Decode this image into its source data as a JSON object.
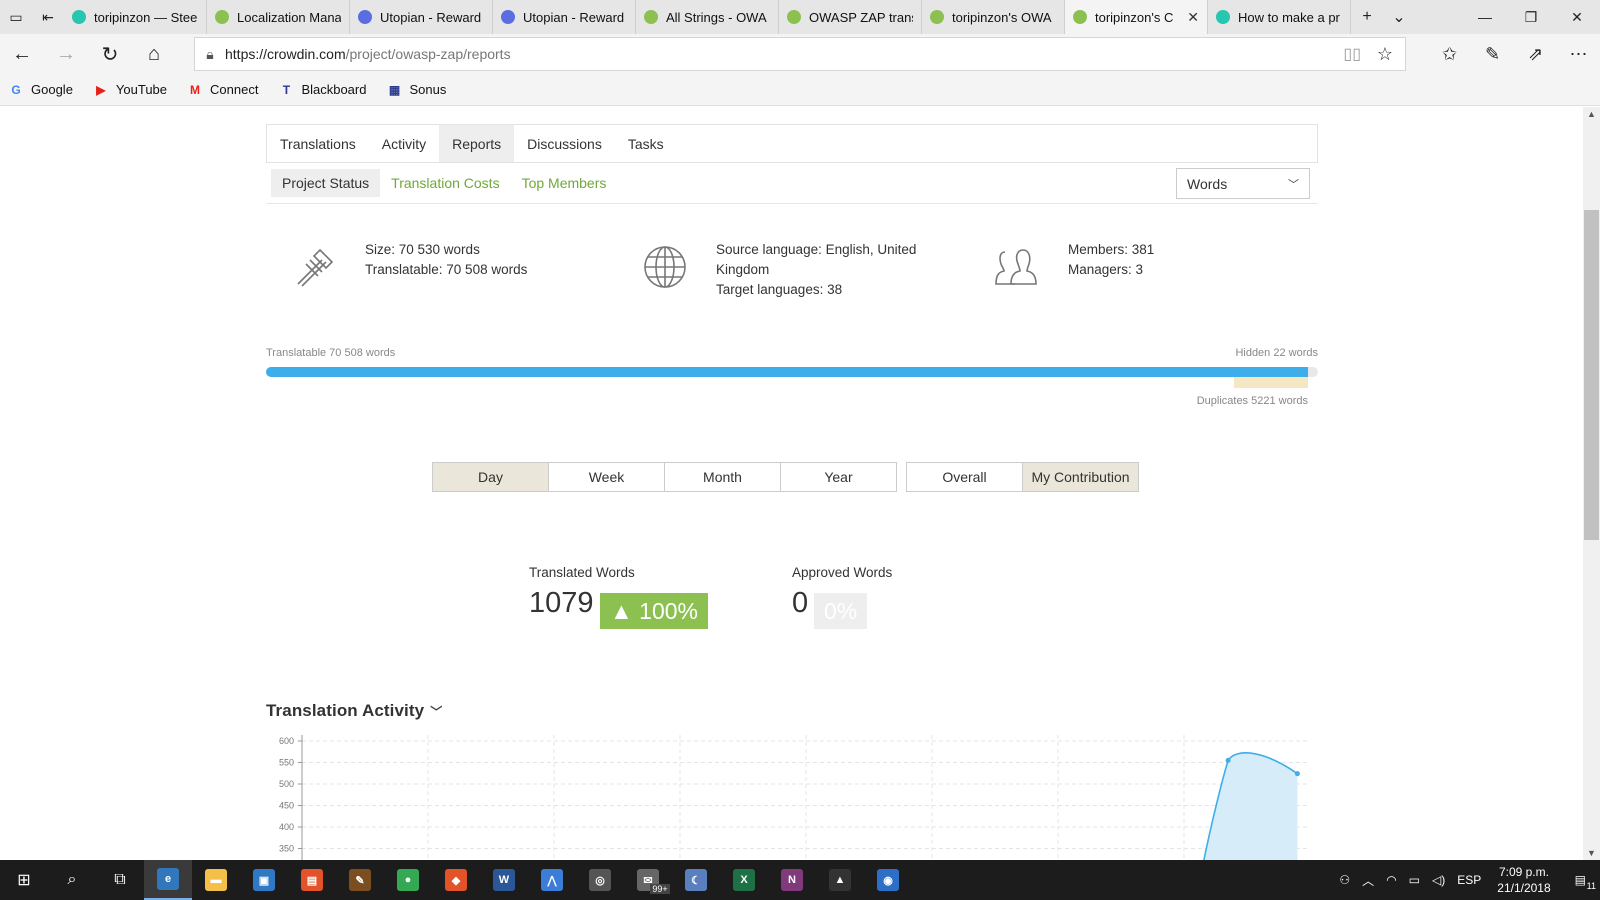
{
  "browser": {
    "tabs": [
      {
        "title": "toripinzon — Stee",
        "color": "#26c6b0"
      },
      {
        "title": "Localization Mana",
        "color": "#8cc152"
      },
      {
        "title": "Utopian - Reward",
        "color": "#5b6ee1"
      },
      {
        "title": "Utopian - Reward",
        "color": "#5b6ee1"
      },
      {
        "title": "All Strings - OWA",
        "color": "#8cc152"
      },
      {
        "title": "OWASP ZAP trans",
        "color": "#8cc152"
      },
      {
        "title": "toripinzon's OWA",
        "color": "#8cc152"
      },
      {
        "title": "toripinzon's C",
        "color": "#8cc152"
      },
      {
        "title": "How to make a pr",
        "color": "#26c6b0"
      }
    ],
    "url_host": "https://crowdin.com",
    "url_path": "/project/owasp-zap/reports",
    "favorites": [
      {
        "label": "Google",
        "icon": "G",
        "color": "#4285f4"
      },
      {
        "label": "YouTube",
        "icon": "▶",
        "color": "#e62117"
      },
      {
        "label": "Connect",
        "icon": "M",
        "color": "#e62117"
      },
      {
        "label": "Blackboard",
        "icon": "T",
        "color": "#2b3a8f"
      },
      {
        "label": "Sonus",
        "icon": "▦",
        "color": "#2b3a8f"
      }
    ]
  },
  "page": {
    "main_tabs": [
      "Translations",
      "Activity",
      "Reports",
      "Discussions",
      "Tasks"
    ],
    "active_main_tab": "Reports",
    "sub_tabs": [
      "Project Status",
      "Translation Costs",
      "Top Members"
    ],
    "units_select": "Words",
    "stats": {
      "size": "Size: 70 530 words",
      "translatable": "Translatable: 70 508 words",
      "source_language_line1": "Source language: English, United",
      "source_language_line2": "Kingdom",
      "target_languages": "Target languages: 38",
      "members": "Members: 381",
      "managers": "Managers: 3"
    },
    "progress": {
      "translatable_label": "Translatable 70 508 words",
      "hidden_label": "Hidden 22 words",
      "duplicates_label": "Duplicates 5221 words",
      "translatable_words": 70508,
      "hidden_words": 22,
      "duplicates_words": 5221,
      "fill_color": "#3daee9"
    },
    "period_buttons": [
      "Day",
      "Week",
      "Month",
      "Year"
    ],
    "active_period": "Day",
    "scope_buttons": [
      "Overall",
      "My Contribution"
    ],
    "active_scope": "My Contribution",
    "metrics": {
      "translated_label": "Translated Words",
      "translated_value": "1079",
      "translated_change": "▲ 100%",
      "approved_label": "Approved Words",
      "approved_value": "0",
      "approved_change": "0%"
    },
    "activity_title": "Translation Activity"
  },
  "chart_data": {
    "type": "area",
    "y_ticks": [
      600,
      550,
      500,
      450,
      400,
      350
    ],
    "ylim": [
      350,
      600
    ],
    "x_columns": 8,
    "points_visible": [
      {
        "col": 7.35,
        "y": 555
      },
      {
        "col": 7.9,
        "y": 524
      }
    ],
    "peak_y": 570,
    "color": "#3daee9",
    "fill": "#d6ecf9"
  },
  "taskbar": {
    "apps": [
      {
        "name": "edge",
        "color": "#3277bc",
        "glyph": "e"
      },
      {
        "name": "file-explorer",
        "color": "#f5c04a",
        "glyph": "▬"
      },
      {
        "name": "store",
        "color": "#2f78c4",
        "glyph": "▣"
      },
      {
        "name": "office",
        "color": "#e2532a",
        "glyph": "▤"
      },
      {
        "name": "app-5",
        "color": "#7a4e21",
        "glyph": "✎"
      },
      {
        "name": "chrome",
        "color": "#34a853",
        "glyph": "●"
      },
      {
        "name": "app-7",
        "color": "#e2532a",
        "glyph": "◆"
      },
      {
        "name": "word",
        "color": "#2b5797",
        "glyph": "W"
      },
      {
        "name": "app-9",
        "color": "#3c7dd8",
        "glyph": "⋀"
      },
      {
        "name": "app-10",
        "color": "#555555",
        "glyph": "◎"
      },
      {
        "name": "mail",
        "color": "#666666",
        "glyph": "✉"
      },
      {
        "name": "app-12",
        "color": "#5a7fbf",
        "glyph": "☾"
      },
      {
        "name": "excel",
        "color": "#1e7145",
        "glyph": "X"
      },
      {
        "name": "onenote",
        "color": "#80397b",
        "glyph": "N"
      },
      {
        "name": "photos",
        "color": "#333333",
        "glyph": "▲"
      },
      {
        "name": "app-16",
        "color": "#2d6fc7",
        "glyph": "◉"
      }
    ],
    "mail_badge": "99+",
    "language": "ESP",
    "time": "7:09 p.m.",
    "date": "21/1/2018",
    "notification_count": "11"
  }
}
